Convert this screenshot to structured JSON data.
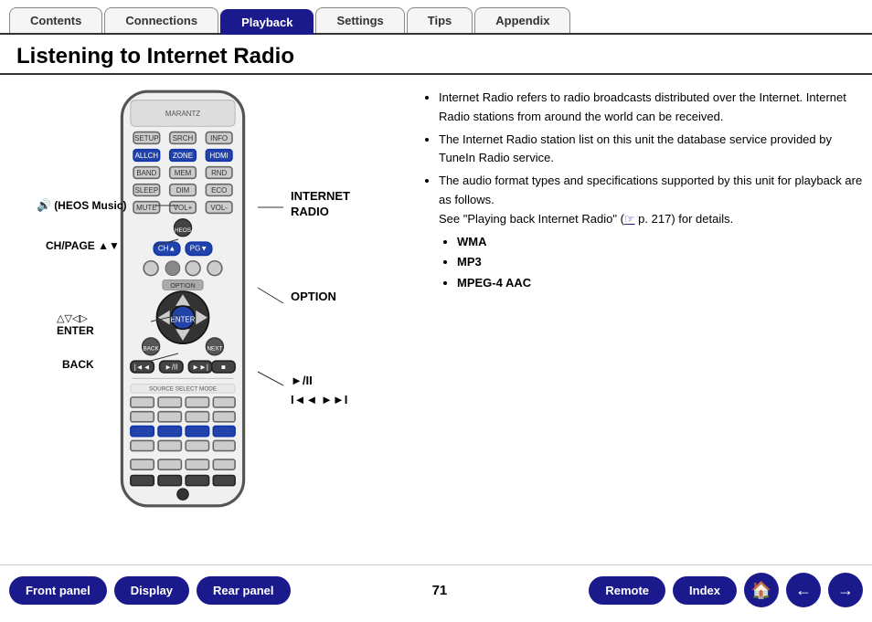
{
  "nav": {
    "tabs": [
      {
        "id": "contents",
        "label": "Contents",
        "active": false
      },
      {
        "id": "connections",
        "label": "Connections",
        "active": false
      },
      {
        "id": "playback",
        "label": "Playback",
        "active": true
      },
      {
        "id": "settings",
        "label": "Settings",
        "active": false
      },
      {
        "id": "tips",
        "label": "Tips",
        "active": false
      },
      {
        "id": "appendix",
        "label": "Appendix",
        "active": false
      }
    ]
  },
  "page": {
    "title": "Listening to Internet Radio"
  },
  "labels": {
    "heos_music": "(HEOS Music)",
    "ch_page": "CH/PAGE ▲▼",
    "enter_arrows": "△▽◁▷",
    "enter": "ENTER",
    "back": "BACK",
    "internet_radio": "INTERNET\nRADIO",
    "option": "OPTION",
    "play_pause": "►/II",
    "skip": "I◄◄  ►►I"
  },
  "bullets": [
    "Internet Radio refers to radio broadcasts distributed over the Internet. Internet Radio stations from around the world can be received.",
    "The Internet Radio station list on this unit the database service provided by TuneIn Radio service.",
    "The audio format types and specifications supported by this unit for playback are as follows."
  ],
  "see_also": "See \"Playing back Internet Radio\" (",
  "see_also_page": " p. 217) for details.",
  "formats": [
    "WMA",
    "MP3",
    "MPEG-4 AAC"
  ],
  "bottom": {
    "front_panel": "Front panel",
    "display": "Display",
    "rear_panel": "Rear panel",
    "page_number": "71",
    "remote": "Remote",
    "index": "Index"
  }
}
